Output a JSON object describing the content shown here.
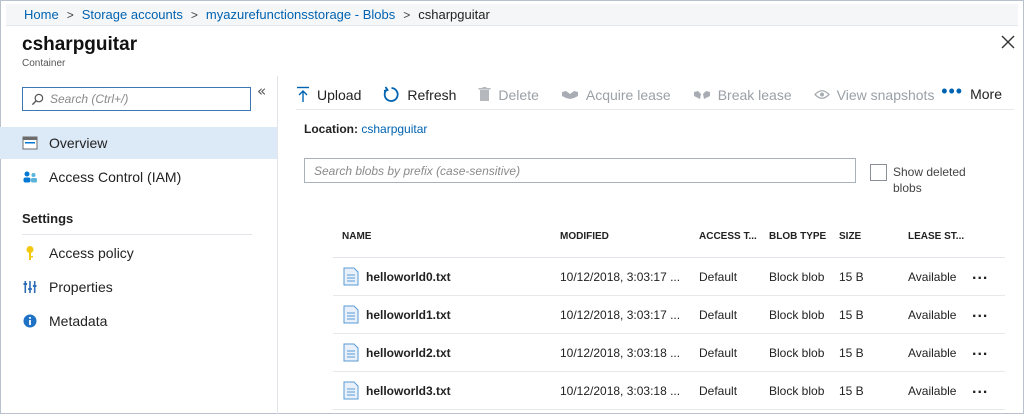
{
  "breadcrumb": {
    "items": [
      "Home",
      "Storage accounts",
      "myazurefunctionsstorage - Blobs"
    ],
    "current": "csharpguitar"
  },
  "header": {
    "title": "csharpguitar",
    "subtitle": "Container"
  },
  "sidebar": {
    "search_placeholder": "Search (Ctrl+/)",
    "items": [
      {
        "label": "Overview",
        "icon": "overview-icon"
      },
      {
        "label": "Access Control (IAM)",
        "icon": "iam-icon"
      }
    ],
    "section_label": "Settings",
    "settings_items": [
      {
        "label": "Access policy",
        "icon": "key-icon"
      },
      {
        "label": "Properties",
        "icon": "properties-icon"
      },
      {
        "label": "Metadata",
        "icon": "info-icon"
      }
    ],
    "collapse_glyph": "«"
  },
  "toolbar": {
    "upload": "Upload",
    "refresh": "Refresh",
    "delete": "Delete",
    "acquire_lease": "Acquire lease",
    "break_lease": "Break lease",
    "view_snapshots": "View snapshots",
    "more": "More"
  },
  "location": {
    "label": "Location:",
    "value": "csharpguitar"
  },
  "blob_search": {
    "placeholder": "Search blobs by prefix (case-sensitive)"
  },
  "show_deleted": {
    "label": "Show deleted blobs",
    "checked": false
  },
  "table": {
    "columns": [
      "NAME",
      "MODIFIED",
      "ACCESS T...",
      "BLOB TYPE",
      "SIZE",
      "LEASE ST..."
    ],
    "rows": [
      {
        "name": "helloworld0.txt",
        "modified": "10/12/2018, 3:03:17 ...",
        "access": "Default",
        "blob_type": "Block blob",
        "size": "15 B",
        "lease": "Available"
      },
      {
        "name": "helloworld1.txt",
        "modified": "10/12/2018, 3:03:17 ...",
        "access": "Default",
        "blob_type": "Block blob",
        "size": "15 B",
        "lease": "Available"
      },
      {
        "name": "helloworld2.txt",
        "modified": "10/12/2018, 3:03:18 ...",
        "access": "Default",
        "blob_type": "Block blob",
        "size": "15 B",
        "lease": "Available"
      },
      {
        "name": "helloworld3.txt",
        "modified": "10/12/2018, 3:03:18 ...",
        "access": "Default",
        "blob_type": "Block blob",
        "size": "15 B",
        "lease": "Available"
      }
    ],
    "row_menu": "..."
  },
  "colors": {
    "accent": "#0063b1",
    "active_nav": "#dce9f6",
    "disabled": "#9aa0a6"
  }
}
